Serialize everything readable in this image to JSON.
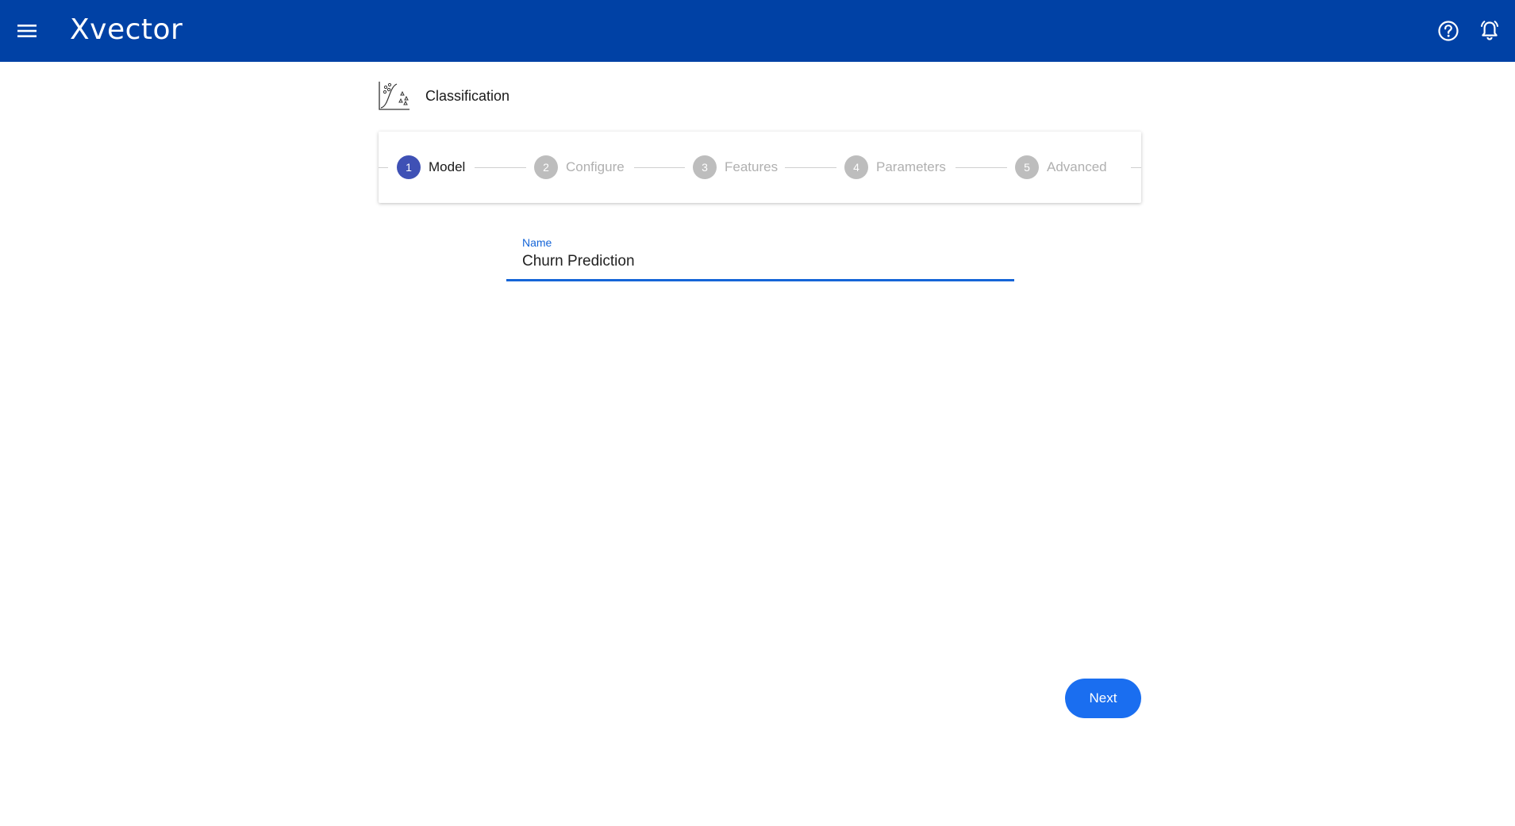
{
  "appbar": {
    "logo": "Xvector",
    "menu_icon": "hamburger-menu-icon",
    "help_icon": "help-circle-icon",
    "notifications_icon": "notification-bell-icon",
    "background": "#0041a5"
  },
  "page": {
    "title": "Classification",
    "title_icon": "classification-chart-icon"
  },
  "stepper": {
    "steps": [
      {
        "number": "1",
        "label": "Model",
        "active": true
      },
      {
        "number": "2",
        "label": "Configure",
        "active": false
      },
      {
        "number": "3",
        "label": "Features",
        "active": false
      },
      {
        "number": "4",
        "label": "Parameters",
        "active": false
      },
      {
        "number": "5",
        "label": "Advanced",
        "active": false
      }
    ],
    "active_color": "#3f51b5",
    "inactive_color": "#bdbdbd"
  },
  "form": {
    "name_label": "Name",
    "name_value": "Churn Prediction",
    "accent": "#1565d8"
  },
  "actions": {
    "next_label": "Next",
    "next_color": "#1a6ef0"
  }
}
